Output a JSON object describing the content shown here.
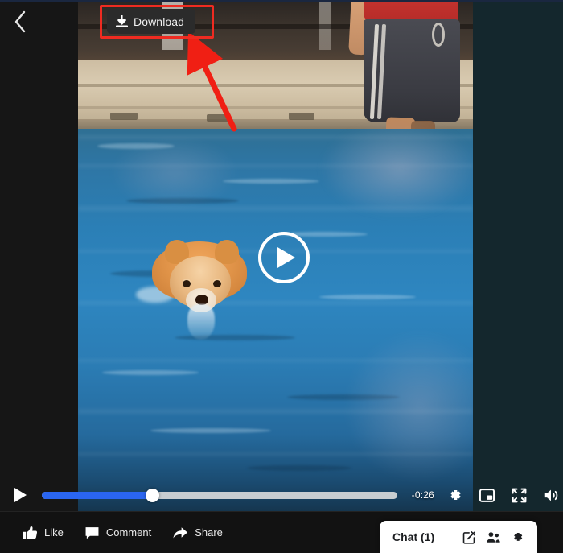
{
  "window": {
    "back_icon": "chevron-left-icon"
  },
  "video": {
    "scene_description": "Dog swimming in a pool with a person standing at the pool edge",
    "download": {
      "label": "Download",
      "icon": "download-arrow-icon",
      "highlight_color": "#ef2b21"
    },
    "annotation": {
      "type": "arrow",
      "color": "#ef2b21",
      "points_to": "Download"
    },
    "center_play": {
      "icon": "play-icon"
    }
  },
  "controls": {
    "play_icon": "play-icon",
    "progress": {
      "percent": 31,
      "fill_color": "#2a65f0",
      "track_color": "#c8cdd0"
    },
    "time_remaining": "-0:26",
    "settings_icon": "gear-icon",
    "pip_icon": "picture-in-picture-icon",
    "fullscreen_icon": "fullscreen-icon",
    "volume_icon": "volume-on-icon"
  },
  "footer": {
    "actions": [
      {
        "label": "Like",
        "icon": "thumbs-up-icon"
      },
      {
        "label": "Comment",
        "icon": "comment-bubble-icon"
      },
      {
        "label": "Share",
        "icon": "share-arrow-icon"
      }
    ]
  },
  "chat": {
    "title": "Chat (1)",
    "icons": [
      {
        "name": "compose-icon"
      },
      {
        "name": "people-group-icon"
      },
      {
        "name": "gear-icon"
      }
    ]
  }
}
